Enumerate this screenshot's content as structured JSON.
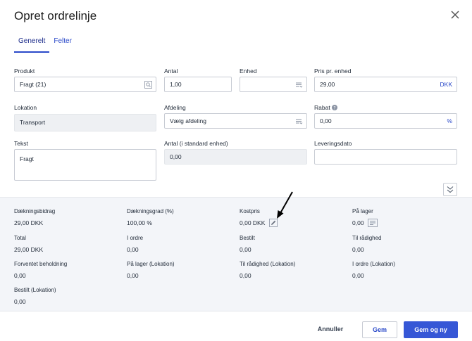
{
  "dialog": {
    "title": "Opret ordrelinje"
  },
  "tabs": [
    {
      "label": "Generelt",
      "active": true
    },
    {
      "label": "Felter",
      "active": false
    }
  ],
  "fields": {
    "produkt": {
      "label": "Produkt",
      "value": "Fragt (21)"
    },
    "antal": {
      "label": "Antal",
      "value": "1,00"
    },
    "enhed": {
      "label": "Enhed",
      "value": ""
    },
    "pris": {
      "label": "Pris pr. enhed",
      "value": "29,00",
      "currency": "DKK"
    },
    "lokation": {
      "label": "Lokation",
      "value": "Transport"
    },
    "afdeling": {
      "label": "Afdeling",
      "placeholder": "Vælg afdeling"
    },
    "rabat": {
      "label": "Rabat",
      "value": "0,00",
      "suffix": "%"
    },
    "tekst": {
      "label": "Tekst",
      "value": "Fragt"
    },
    "antal_std": {
      "label": "Antal (i standard enhed)",
      "value": "0,00"
    },
    "levering": {
      "label": "Leveringsdato",
      "value": ""
    }
  },
  "info": {
    "daekningsbidrag": {
      "label": "Dækningsbidrag",
      "value": "29,00 DKK"
    },
    "daekningsgrad": {
      "label": "Dækningsgrad (%)",
      "value": "100,00 %"
    },
    "kostpris": {
      "label": "Kostpris",
      "value": "0,00 DKK"
    },
    "paa_lager": {
      "label": "På lager",
      "value": "0,00"
    },
    "total": {
      "label": "Total",
      "value": "29,00 DKK"
    },
    "i_ordre": {
      "label": "I ordre",
      "value": "0,00"
    },
    "bestilt": {
      "label": "Bestilt",
      "value": "0,00"
    },
    "til_raadighed": {
      "label": "Til rådighed",
      "value": "0,00"
    },
    "forventet": {
      "label": "Forventet beholdning",
      "value": "0,00"
    },
    "paa_lager_lok": {
      "label": "På lager (Lokation)",
      "value": "0,00"
    },
    "til_raadighed_lok": {
      "label": "Til rådighed (Lokation)",
      "value": "0,00"
    },
    "i_ordre_lok": {
      "label": "I ordre (Lokation)",
      "value": "0,00"
    },
    "bestilt_lok": {
      "label": "Bestilt (Lokation)",
      "value": "0,00"
    }
  },
  "buttons": {
    "cancel": "Annuller",
    "save": "Gem",
    "save_new": "Gem og ny"
  },
  "colors": {
    "accent": "#2a49c9",
    "primary_button": "#3657d6",
    "panel_bg": "#f3f5f9"
  }
}
